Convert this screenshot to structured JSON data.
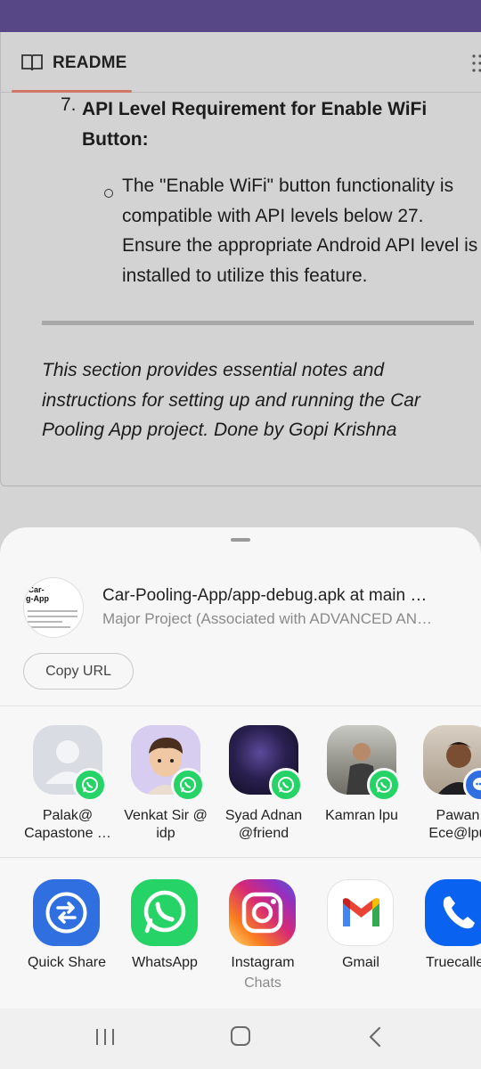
{
  "readme": {
    "tab_label": "README",
    "item_number": "7.",
    "item_heading": "API Level Requirement for Enable WiFi Button:",
    "bullet_text": "The \"Enable WiFi\" button functionality is compatible with API levels below 27. Ensure the appropriate Android API level is installed to utilize this feature.",
    "note": "This section provides essential notes and instructions for setting up and running the Car Pooling App project. Done by Gopi Krishna"
  },
  "share": {
    "preview_thumb_text": "/Car-\ng-App",
    "link_title": "Car-Pooling-App/app-debug.apk at main …",
    "link_subtitle": "Major Project (Associated with ADVANCED AN…",
    "copy_url_label": "Copy URL",
    "contacts": [
      {
        "name": "Palak@\nCapastone …",
        "badge": "whatsapp-icon"
      },
      {
        "name": "Venkat Sir @\nidp",
        "badge": "whatsapp-icon"
      },
      {
        "name": "Syad Adnan\n@friend",
        "badge": "whatsapp-icon"
      },
      {
        "name": "Kamran lpu",
        "badge": "whatsapp-icon"
      },
      {
        "name": "Pawan\nEce@lpu",
        "badge": "messages-icon"
      }
    ],
    "apps": [
      {
        "label": "Quick Share",
        "sublabel": "",
        "icon": "quick-share-icon"
      },
      {
        "label": "WhatsApp",
        "sublabel": "",
        "icon": "whatsapp-icon"
      },
      {
        "label": "Instagram",
        "sublabel": "Chats",
        "icon": "instagram-icon"
      },
      {
        "label": "Gmail",
        "sublabel": "",
        "icon": "gmail-icon"
      },
      {
        "label": "Truecaller",
        "sublabel": "",
        "icon": "truecaller-icon"
      }
    ]
  },
  "colors": {
    "status_bar": "#584786",
    "tab_underline": "#d17565",
    "whatsapp": "#25d366",
    "quick_share": "#2f6fe0",
    "truecaller": "#0a63f0"
  }
}
